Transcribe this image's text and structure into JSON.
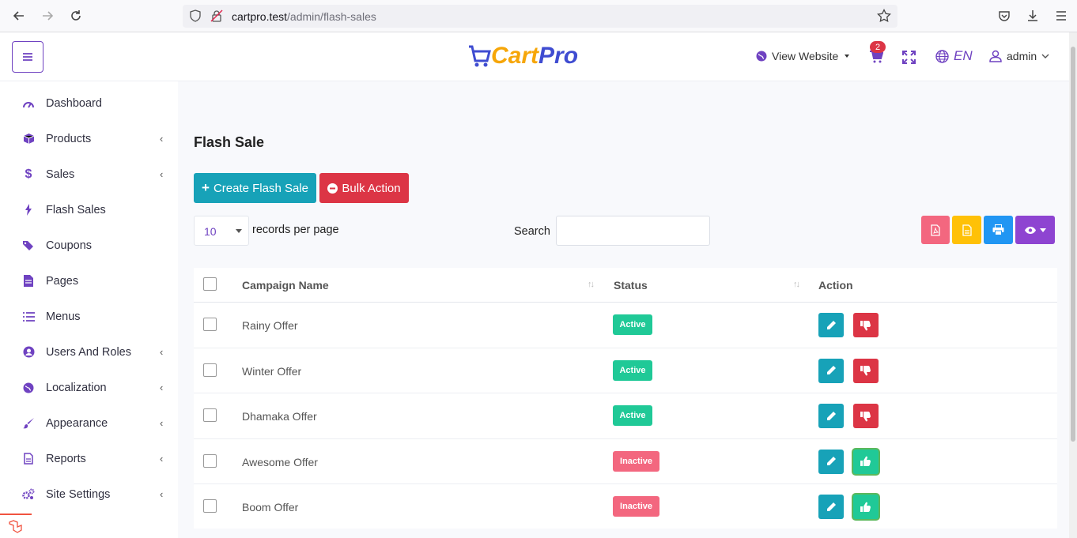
{
  "browser": {
    "url_host": "cartpro.test",
    "url_path": "/admin/flash-sales"
  },
  "header": {
    "logo_part1": "Cart",
    "logo_part2": "Pro",
    "view_website": "View Website",
    "cart_count": "2",
    "language": "EN",
    "user": "admin"
  },
  "sidebar": {
    "items": [
      {
        "label": "Dashboard",
        "icon": "gauge-icon",
        "has_children": false
      },
      {
        "label": "Products",
        "icon": "cube-icon",
        "has_children": true
      },
      {
        "label": "Sales",
        "icon": "dollar-icon",
        "has_children": true
      },
      {
        "label": "Flash Sales",
        "icon": "bolt-icon",
        "has_children": false
      },
      {
        "label": "Coupons",
        "icon": "tags-icon",
        "has_children": false
      },
      {
        "label": "Pages",
        "icon": "file-icon",
        "has_children": false
      },
      {
        "label": "Menus",
        "icon": "list-icon",
        "has_children": false
      },
      {
        "label": "Users And Roles",
        "icon": "user-circle-icon",
        "has_children": true
      },
      {
        "label": "Localization",
        "icon": "globe-icon",
        "has_children": true
      },
      {
        "label": "Appearance",
        "icon": "brush-icon",
        "has_children": true
      },
      {
        "label": "Reports",
        "icon": "report-icon",
        "has_children": true
      },
      {
        "label": "Site Settings",
        "icon": "cogs-icon",
        "has_children": true
      }
    ]
  },
  "main": {
    "title": "Flash Sale",
    "create_label": "Create Flash Sale",
    "bulk_label": "Bulk Action",
    "per_page_value": "10",
    "per_page_label": "records per page",
    "search_label": "Search",
    "search_value": ""
  },
  "colors": {
    "accent": "#6f42c1",
    "info": "#17a2b8",
    "danger": "#dc3545",
    "success": "#20c997",
    "inactive": "#f3677f"
  },
  "table": {
    "columns": [
      "Campaign Name",
      "Status",
      "Action"
    ],
    "rows": [
      {
        "name": "Rainy Offer",
        "status": "Active"
      },
      {
        "name": "Winter Offer",
        "status": "Active"
      },
      {
        "name": "Dhamaka Offer",
        "status": "Active"
      },
      {
        "name": "Awesome Offer",
        "status": "Inactive"
      },
      {
        "name": "Boom Offer",
        "status": "Inactive"
      }
    ]
  }
}
